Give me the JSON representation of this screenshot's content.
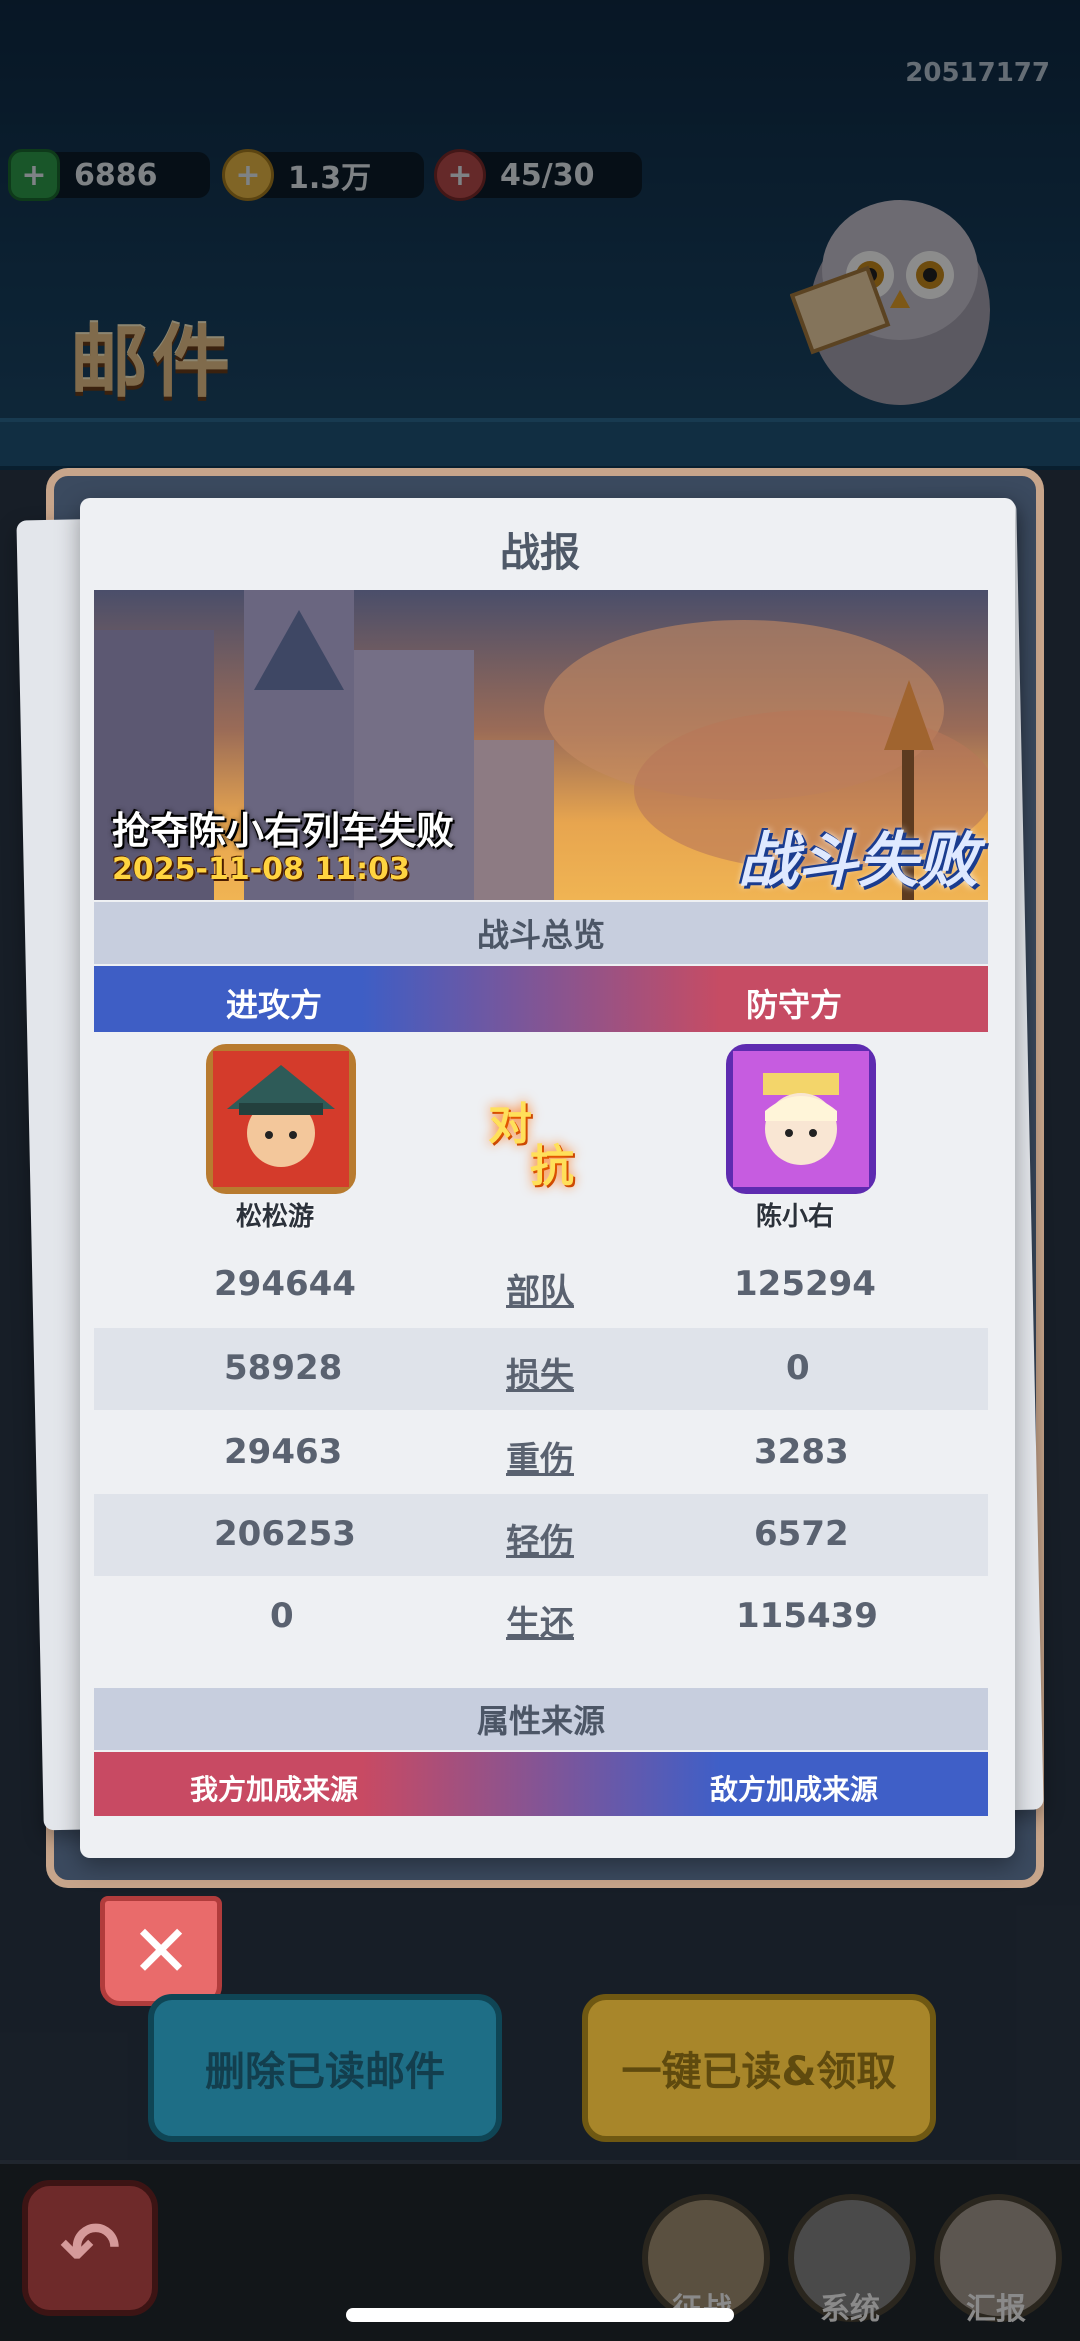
{
  "header": {
    "uid": "20517177",
    "resources": [
      {
        "icon": "gem-plus-icon",
        "value": "6886"
      },
      {
        "icon": "coin-plus-icon",
        "value": "1.3万"
      },
      {
        "icon": "meat-plus-icon",
        "value": "45/30"
      }
    ],
    "mail_title": "邮件"
  },
  "report": {
    "title": "战报",
    "battle_name": "抢夺陈小右列车失败",
    "battle_time": "2025-11-08 11:03",
    "result": "战斗失败",
    "overview_title": "战斗总览",
    "attacker_label": "进攻方",
    "defender_label": "防守方",
    "attacker_name": "松松游",
    "defender_name": "陈小右",
    "vs_text_1": "对",
    "vs_text_2": "抗",
    "stats": [
      {
        "label": "部队",
        "attacker": "294644",
        "defender": "125294"
      },
      {
        "label": "损失",
        "attacker": "58928",
        "defender": "0"
      },
      {
        "label": "重伤",
        "attacker": "29463",
        "defender": "3283"
      },
      {
        "label": "轻伤",
        "attacker": "206253",
        "defender": "6572"
      },
      {
        "label": "生还",
        "attacker": "0",
        "defender": "115439"
      }
    ],
    "attr_title": "属性来源",
    "my_bonus": "我方加成来源",
    "enemy_bonus": "敌方加成来源"
  },
  "buttons": {
    "close": "✕",
    "delete_read": "删除已读邮件",
    "read_claim": "一键已读&领取"
  },
  "bottom_nav": {
    "back_icon": "back-arrow-icon",
    "items": [
      {
        "icon": "swords-icon",
        "label": "征战"
      },
      {
        "icon": "gear-icon",
        "label": "系统"
      },
      {
        "icon": "envelope-icon",
        "label": "汇报"
      }
    ]
  }
}
